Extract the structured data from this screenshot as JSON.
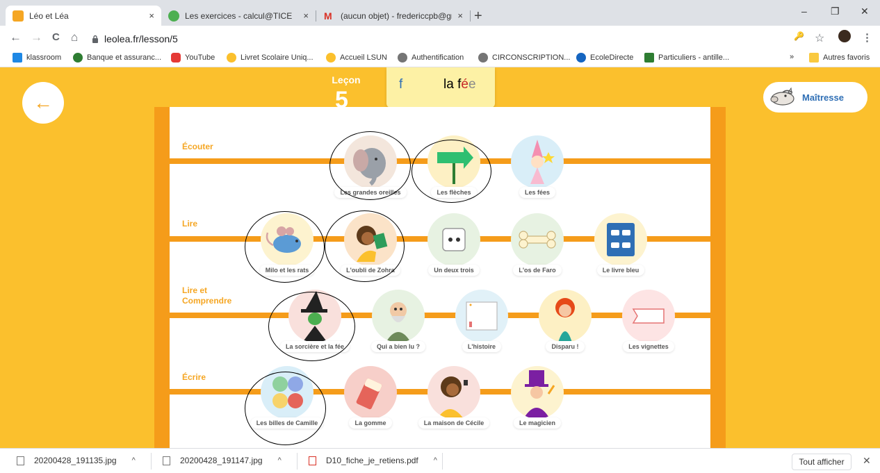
{
  "browser": {
    "tabs": [
      {
        "title": "Léo et Léa",
        "close": "×",
        "favicon_color": "#f5a623"
      },
      {
        "title": "Les exercices - calcul@TICE",
        "close": "×",
        "favicon_color": "#4caf50"
      },
      {
        "title": "(aucun objet) - fredericcpb@gma",
        "close": "×",
        "favicon_color": "#d93025"
      }
    ],
    "new_tab": "+",
    "window_controls": {
      "minimize": "–",
      "restore": "❐",
      "close": "✕"
    },
    "nav": {
      "back": "←",
      "forward": "→",
      "reload": "C",
      "home": "⌂"
    },
    "url": "leolea.fr/lesson/5",
    "right_icons": {
      "key": "🔑",
      "star": "☆",
      "menu": "⋮"
    },
    "bookmarks": [
      {
        "label": "klassroom",
        "color": "#1e88e5"
      },
      {
        "label": "Banque et assuranc...",
        "color": "#2e7d32"
      },
      {
        "label": "YouTube",
        "color": "#e53935"
      },
      {
        "label": "Livret Scolaire Uniq...",
        "color": "#fbc02d"
      },
      {
        "label": "Accueil LSUN",
        "color": "#fbc02d"
      },
      {
        "label": "Authentification",
        "color": "#757575"
      },
      {
        "label": "CIRCONSCRIPTION...",
        "color": "#757575"
      },
      {
        "label": "EcoleDirecte",
        "color": "#1565c0"
      },
      {
        "label": "Particuliers - antille...",
        "color": "#2e7d32"
      }
    ],
    "bookmarks_more": "»",
    "other_favorites": "Autres favoris"
  },
  "page": {
    "back_arrow": "←",
    "lesson_label": "Leçon",
    "lesson_number": "5",
    "note_letter": "f",
    "note_word_a": "la f",
    "note_word_b": "é",
    "note_word_c": "e",
    "teacher_button": "Maîtresse",
    "sections": [
      {
        "label": "Écouter",
        "activities": [
          "Les grandes oreilles",
          "Les flèches",
          "Les fées"
        ]
      },
      {
        "label": "Lire",
        "activities": [
          "Milo et les rats",
          "L'oubli de Zohra",
          "Un deux trois",
          "L'os de Faro",
          "Le livre bleu"
        ]
      },
      {
        "label_line1": "Lire et",
        "label_line2": "Comprendre",
        "activities": [
          "La sorcière et la fée",
          "Qui a bien lu ?",
          "L'histoire",
          "Disparu !",
          "Les vignettes"
        ]
      },
      {
        "label": "Écrire",
        "activities": [
          "Les billes de Camille",
          "La gomme",
          "La maison de Cécile",
          "Le magicien"
        ]
      }
    ]
  },
  "downloads": {
    "files": [
      {
        "name": "20200428_191135.jpg",
        "chevron": "^"
      },
      {
        "name": "20200428_191147.jpg",
        "chevron": "^"
      },
      {
        "name": "D10_fiche_je_retiens.pdf",
        "chevron": "^"
      }
    ],
    "show_all": "Tout afficher",
    "close": "✕"
  },
  "colors": {
    "page_bg": "#fbc02d",
    "rail": "#f59c1a",
    "section_label": "#f5a623",
    "teacher_text": "#2f6fb5"
  }
}
